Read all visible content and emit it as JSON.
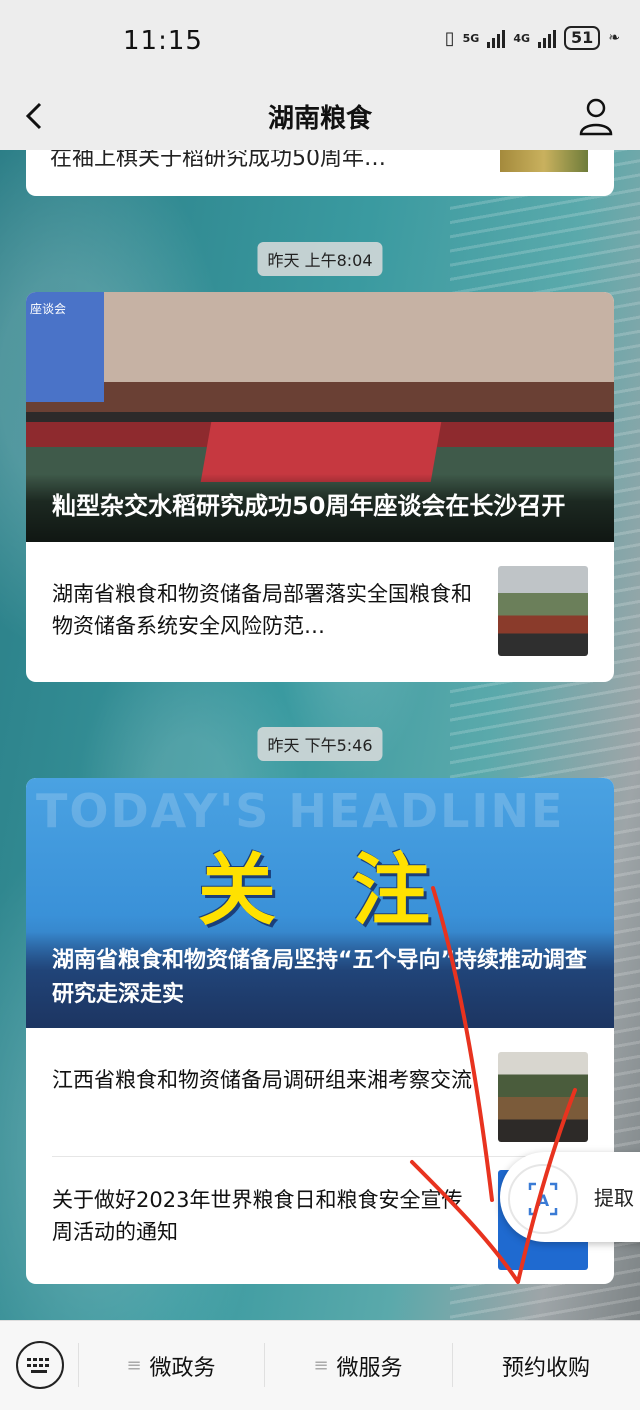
{
  "status_bar": {
    "time": "11:15",
    "net1": "5G",
    "net2": "4G",
    "battery": "51"
  },
  "nav": {
    "title": "湖南粮食"
  },
  "feed": {
    "top_card_cut": "在袖上棋关于稻研究成功50周年…",
    "group1": {
      "timestamp": "昨天 上午8:04",
      "cover_title": "籼型杂交水稻研究成功50周年座谈会在长沙召开",
      "cover_watermark": "座谈会",
      "items": [
        {
          "title": "湖南省粮食和物资储备局部署落实全国粮食和物资储备系统安全风险防范…"
        }
      ]
    },
    "group2": {
      "timestamp": "昨天 下午5:46",
      "cover_watermark": "TODAY'S HEADLINE",
      "cover_word1": "关",
      "cover_word2": "注",
      "cover_title": "湖南省粮食和物资储备局坚持“五个导向”持续推动调查研究走深走实",
      "items": [
        {
          "title": "江西省粮食和物资储备局调研组来湘考察交流"
        },
        {
          "title": "关于做好2023年世界粮食日和粮食安全宣传周活动的通知"
        }
      ]
    }
  },
  "extract_button": {
    "label": "提取"
  },
  "bottom_menu": {
    "items": [
      {
        "label": "微政务"
      },
      {
        "label": "微服务"
      },
      {
        "label": "预约收购"
      }
    ]
  },
  "colors": {
    "accent_yellow": "#ffe100",
    "annotation_red": "#e8331f"
  }
}
